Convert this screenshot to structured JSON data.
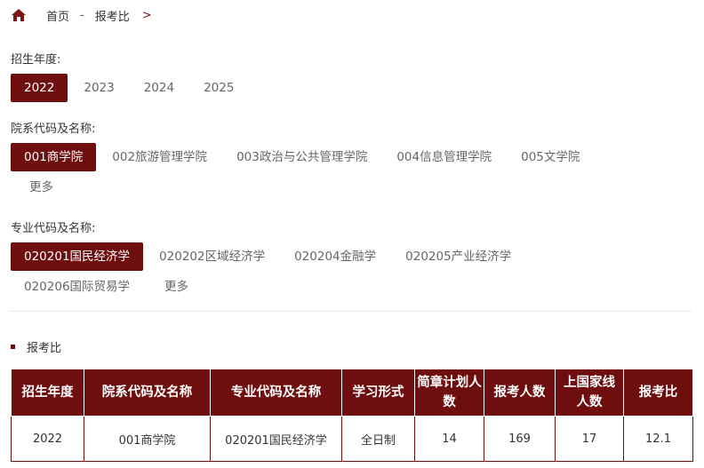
{
  "breadcrumb": {
    "home_label": "首页",
    "separator": "-",
    "current": "报考比",
    "chevron": ">"
  },
  "filters": {
    "year": {
      "label": "招生年度:",
      "options": [
        "2022",
        "2023",
        "2024",
        "2025"
      ],
      "selected_index": 0
    },
    "dept": {
      "label": "院系代码及名称:",
      "options": [
        "001商学院",
        "002旅游管理学院",
        "003政治与公共管理学院",
        "004信息管理学院",
        "005文学院",
        "更多"
      ],
      "selected_index": 0
    },
    "major": {
      "label": "专业代码及名称:",
      "options": [
        "020201国民经济学",
        "020202区域经济学",
        "020204金融学",
        "020205产业经济学",
        "020206国际贸易学",
        "更多"
      ],
      "selected_index": 0
    }
  },
  "section": {
    "title": "报考比"
  },
  "table": {
    "headers": [
      "招生年度",
      "院系代码及名称",
      "专业代码及名称",
      "学习形式",
      "简章计划人数",
      "报考人数",
      "上国家线人数",
      "报考比"
    ],
    "rows": [
      [
        "2022",
        "001商学院",
        "020201国民经济学",
        "全日制",
        "14",
        "169",
        "17",
        "12.1"
      ]
    ]
  },
  "colors": {
    "accent": "#6e0e0e",
    "text": "#333333",
    "muted": "#666666",
    "divider": "#e8e8e8"
  }
}
